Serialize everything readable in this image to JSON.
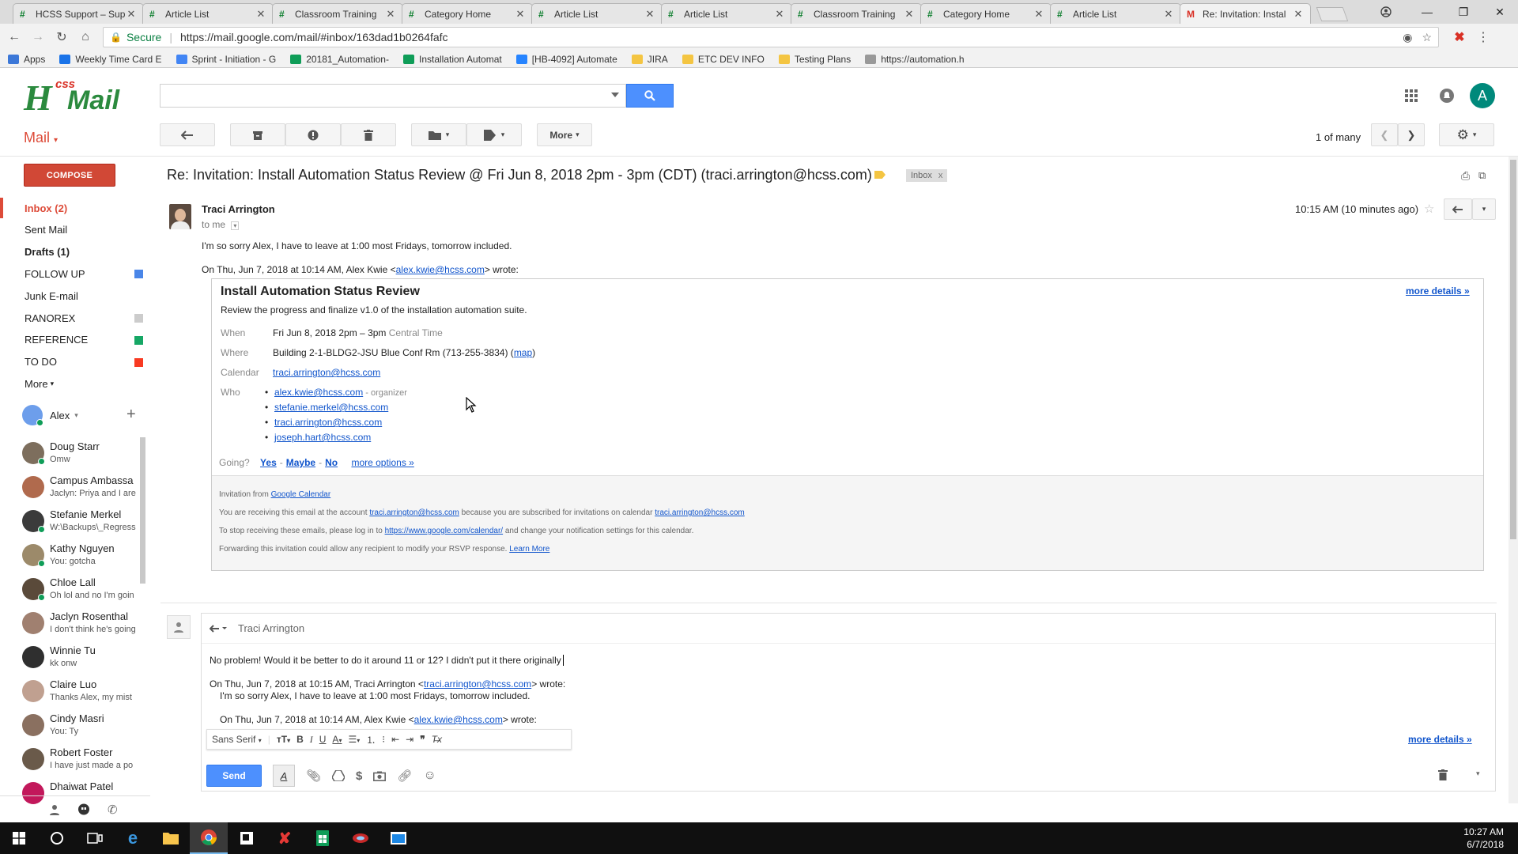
{
  "browser": {
    "tabs": [
      {
        "label": "HCSS Support – Sup",
        "icon": "hcss"
      },
      {
        "label": "Article List",
        "icon": "hcss"
      },
      {
        "label": "Classroom Training",
        "icon": "hcss"
      },
      {
        "label": "Category Home",
        "icon": "hcss"
      },
      {
        "label": "Article List",
        "icon": "hcss"
      },
      {
        "label": "Article List",
        "icon": "hcss"
      },
      {
        "label": "Classroom Training",
        "icon": "hcss"
      },
      {
        "label": "Category Home",
        "icon": "hcss"
      },
      {
        "label": "Article List",
        "icon": "hcss"
      },
      {
        "label": "Re: Invitation: Instal",
        "icon": "gmail"
      }
    ],
    "secure_label": "Secure",
    "url": "https://mail.google.com/mail/#inbox/163dad1b0264fafc",
    "bookmarks": [
      {
        "label": "Apps",
        "color": "#3c78d8"
      },
      {
        "label": "Weekly Time Card E",
        "color": "#1a73e8"
      },
      {
        "label": "Sprint - Initiation - G",
        "color": "#4285f4"
      },
      {
        "label": "20181_Automation-",
        "color": "#0f9d58"
      },
      {
        "label": "Installation Automat",
        "color": "#0f9d58"
      },
      {
        "label": "[HB-4092] Automate",
        "color": "#2684ff"
      },
      {
        "label": "JIRA",
        "color": "#f4c542"
      },
      {
        "label": "ETC DEV INFO",
        "color": "#f4c542"
      },
      {
        "label": "Testing Plans",
        "color": "#f4c542"
      },
      {
        "label": "https://automation.h",
        "color": "#999999"
      }
    ]
  },
  "header": {
    "logo_css": "css",
    "logo_mail": "Mail",
    "logo_h": "H",
    "avatar_letter": "A"
  },
  "toolbar": {
    "mail_label": "Mail",
    "more_label": "More",
    "page_count": "1 of many"
  },
  "nav": {
    "compose": "COMPOSE",
    "items": [
      {
        "label": "Inbox (2)",
        "style": "sel"
      },
      {
        "label": "Sent Mail",
        "style": ""
      },
      {
        "label": "Drafts (1)",
        "style": "bold"
      },
      {
        "label": "FOLLOW UP",
        "style": "",
        "color": "#4a86e8"
      },
      {
        "label": "Junk E-mail",
        "style": ""
      },
      {
        "label": "RANOREX",
        "style": "",
        "color": "#cccccc"
      },
      {
        "label": "REFERENCE",
        "style": "",
        "color": "#16a765"
      },
      {
        "label": "TO DO",
        "style": "",
        "color": "#f83a22"
      },
      {
        "label": "More",
        "style": ""
      }
    ],
    "me": "Alex",
    "people": [
      {
        "name": "Doug Starr",
        "msg": "Omw",
        "online": true
      },
      {
        "name": "Campus Ambassa",
        "msg": "Jaclyn: Priya and I are",
        "online": false
      },
      {
        "name": "Stefanie Merkel",
        "msg": "W:\\Backups\\_Regress",
        "online": true
      },
      {
        "name": "Kathy Nguyen",
        "msg": "You: gotcha",
        "online": true
      },
      {
        "name": "Chloe Lall",
        "msg": "Oh lol and no I'm goin",
        "online": true
      },
      {
        "name": "Jaclyn Rosenthal",
        "msg": "I don't think he's going",
        "online": false
      },
      {
        "name": "Winnie Tu",
        "msg": "kk onw",
        "online": false
      },
      {
        "name": "Claire Luo",
        "msg": "Thanks Alex, my mist",
        "online": false
      },
      {
        "name": "Cindy Masri",
        "msg": "You: Ty",
        "online": false
      },
      {
        "name": "Robert Foster",
        "msg": "I have just made a po",
        "online": false
      },
      {
        "name": "Dhaiwat Patel",
        "msg": "",
        "online": false
      }
    ]
  },
  "message": {
    "subject": "Re: Invitation: Install Automation Status Review @ Fri Jun 8, 2018 2pm - 3pm (CDT) (traci.arrington@hcss.com)",
    "label_inbox": "Inbox",
    "sender": "Traci Arrington",
    "to": "to me",
    "time": "10:15 AM (10 minutes ago)",
    "body": "I'm so sorry Alex, I have to leave at 1:00 most Fridays, tomorrow included.",
    "quote_prefix": "On Thu, Jun 7, 2018 at 10:14 AM, Alex Kwie <",
    "quote_email": "alex.kwie@hcss.com",
    "quote_suffix": "> wrote:"
  },
  "invite": {
    "title": "Install Automation Status Review",
    "subtitle": "Review the progress and finalize v1.0 of the installation automation suite.",
    "more_details": "more details »",
    "when_label": "When",
    "when_value": "Fri Jun 8, 2018 2pm – 3pm",
    "when_tz": "Central Time",
    "where_label": "Where",
    "where_value": "Building 2-1-BLDG2-JSU Blue Conf Rm (713-255-3834) (",
    "where_map": "map",
    "where_close": ")",
    "calendar_label": "Calendar",
    "calendar_value": "traci.arrington@hcss.com",
    "who_label": "Who",
    "who": [
      {
        "email": "alex.kwie@hcss.com",
        "note": " - organizer"
      },
      {
        "email": "stefanie.merkel@hcss.com",
        "note": ""
      },
      {
        "email": "traci.arrington@hcss.com",
        "note": ""
      },
      {
        "email": "joseph.hart@hcss.com",
        "note": ""
      }
    ],
    "going_label": "Going?",
    "going_yes": "Yes",
    "going_maybe": "Maybe",
    "going_no": "No",
    "going_more": "more options »",
    "foot_invitation_from": "Invitation from ",
    "foot_gcal": "Google Calendar",
    "foot_line2_a": "You are receiving this email at the account ",
    "foot_line2_email": "traci.arrington@hcss.com",
    "foot_line2_b": " because you are subscribed for invitations on calendar ",
    "foot_line2_email2": "traci.arrington@hcss.com",
    "foot_line3_a": "To stop receiving these emails, please log in to ",
    "foot_line3_link": "https://www.google.com/calendar/",
    "foot_line3_b": " and change your notification settings for this calendar.",
    "foot_line4_a": "Forwarding this invitation could allow any recipient to modify your RSVP response. ",
    "foot_line4_link": "Learn More"
  },
  "reply": {
    "to": "Traci Arrington",
    "text": "No problem! Would it be better to do it around 11 or 12? I didn't put it there originally",
    "q1_prefix": "On Thu, Jun 7, 2018 at 10:15 AM, Traci Arrington <",
    "q1_email": "traci.arrington@hcss.com",
    "q1_suffix": "> wrote:",
    "q2": "I'm so sorry Alex, I have to leave at 1:00 most Fridays, tomorrow included.",
    "q3_prefix": "On Thu, Jun 7, 2018 at 10:14 AM, Alex Kwie <",
    "q3_email": "alex.kwie@hcss.com",
    "q3_suffix": "> wrote:",
    "more_details": "more details »",
    "font": "Sans Serif",
    "send": "Send"
  },
  "taskbar": {
    "time": "10:27 AM",
    "date": "6/7/2018"
  }
}
